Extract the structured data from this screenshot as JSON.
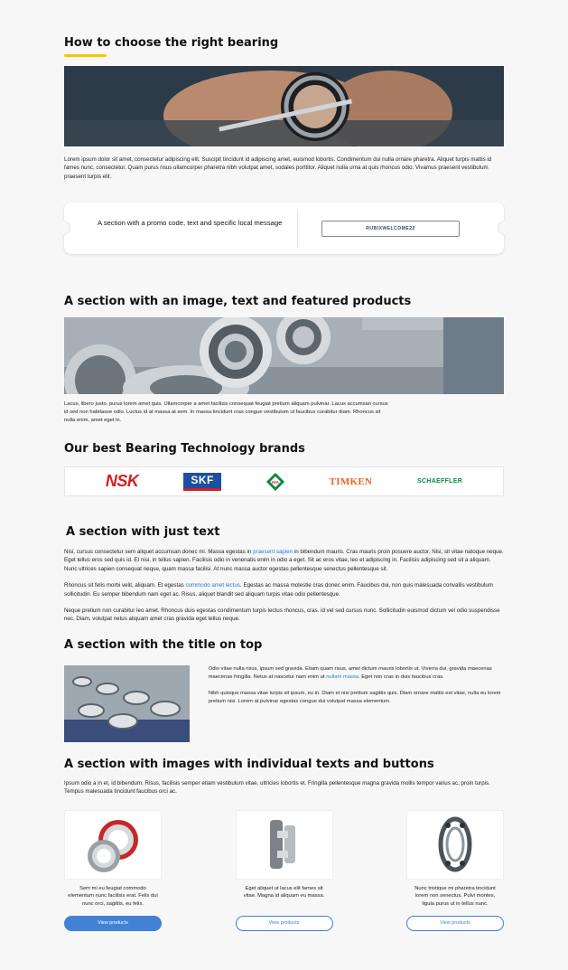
{
  "section_promo_article": {
    "title": "How to choose the right bearing",
    "paragraph": "Lorem ipsum dolor sit amet, consectetur adipiscing elit. Suscipit tincidunt id adipiscing amet, euismod lobortis. Condimentum dui nulla ornare pharetra. Aliquet turpis mattis id fames nunc, consectetur. Quam purus risus ullamcorper pharetra nibh volutpat amet, sodales porttitor. Aliquet nulla urna at quis rhoncus odio. Vivamus praesent vestibulum praesent turpis elit."
  },
  "promo": {
    "message": "A section with a promo code, text and specific local message",
    "code": "RUBIXWELCOME22"
  },
  "section_featured": {
    "title": "A section with an image, text and featured products",
    "paragraph": "Lacus, libero justo, purus lorem amet quis. Ullamcorper a amet facilisis consequat feugiat pretium aliquam pulvinar. Lacus accumsan cursus id sed non habitasse odio. Luctus id at massa at sem. In massa tincidunt cras congue vestibulum ut faucibus curabitur diam. Rhoncus sit nulla enim, amet eget in."
  },
  "brands": {
    "title": "Our best Bearing Technology brands",
    "items": [
      "NSK",
      "SKF",
      "INA",
      "TIMKEN",
      "SCHAEFFLER"
    ],
    "colors": {
      "nsk": "#d41d24",
      "skf": "#1c4fa0",
      "ina": "#0a8a3c",
      "timken": "#e8641a",
      "schaeffler": "#0a8a3c"
    }
  },
  "section_text": {
    "title": "A section with just text",
    "p1_before": "Nisi, cursus consectetur sem aliquet accumsan donec mi. Massa egestas in ",
    "p1_link": "praesent sapien",
    "p1_after": " in bibendum mauris. Cras mauris proin posuere auctor. Nisi, sit vitae natoque neque. Eget tellus eros sed quis id. Et nisi, in tellus sapien. Facilisis odio in venenatis enim in odio a eget. Sit ac eros vitae, leo et adipiscing in. Facilisis adipiscing sed sit a aliquam. Nunc ultrices sapien consequat neque, quam massa facilisi. At nunc massa auctor egestas pellentesque senectus pellentesque sit.",
    "p2_before": "Rhoncus sit felis morbi velit, aliquam. Et egestas ",
    "p2_link": "commodo amet lectus",
    "p2_after": ". Egestas ac massa molestie cras donec enim. Faucibus dui, non quis malesuada convallis vestibulum sollicitudin. Eu semper bibendum nam eget ac. Risus, aliquet blandit sed aliquam turpis vitae odio pellentesque.",
    "p3": "Neque pretium non curabitur leo amet. Rhoncus duis egestas condimentum turpis lectus rhoncus, cras. id vel sed cursus nunc. Sollicitudin euismod dictum vel odio suspendisse nec. Diam, volutpat netus aliquam amet cras gravida eget tellus neque."
  },
  "section_title_top": {
    "title": "A section with the title on top",
    "p1_before": "Odio vitae nulla risus, ipsum sed gravida. Etiam quam risus, amet dictum mauris lobortis ut. Viverra dui, gravida maecenas maecenas fringilla. Netus at nascetur nam enim ut ",
    "p1_link": "nullam massa",
    "p1_after": ". Eget non cras in duis faucibus cras.",
    "p2": "Nibh quisque massa vitae turpis sit ipsum, eu in. Diam et nisi pretium sagittis quis. Diam ornare mattis est vitae, nulla eu lorem pretium nisi. Lorem at pulvinar egestas congue dui volutpat massa elementum."
  },
  "section_cards": {
    "title": "A section with images with individual texts and buttons",
    "intro": "Ipsum odio a in et, id bibendum. Risus, facilisis semper etiam vestibulum vitae, ultricies lobortis et. Fringilla pellentesque magna gravida mollis tempor varius ac, proin turpis. Tempus malesuada tincidunt faucibus orci ac.",
    "cards": [
      {
        "text": "Sem mi eu feugiat commodo elementum nunc facilisis erat. Felis dui nunc orci, sagittis, eu felis.",
        "button": "View products"
      },
      {
        "text": "Eget aliquet ut lacus elit fames sit vitae. Magna id aliquam eu massa.",
        "button": "View products"
      },
      {
        "text": "Nunc tristique mi pharetra tincidunt lorem non senectus. Pulvi montes, ligula purus ut in tellus nunc.",
        "button": "View products"
      }
    ]
  }
}
